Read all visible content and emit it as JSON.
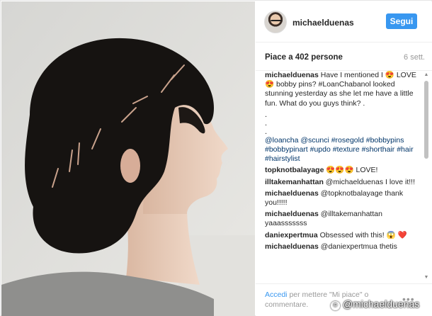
{
  "post": {
    "username": "michaelduenas",
    "follow_label": "Segui",
    "likes": "Piace a 402 persone",
    "date": "6 sett."
  },
  "comments": [
    {
      "user": "michaelduenas",
      "text": "Have I mentioned I 😍 LOVE 😍 bobby pins? #LoanChabanol looked stunning yesterday as she let me have a little fun. What do you guys think? ."
    },
    {
      "user": "",
      "text": "."
    },
    {
      "user": "",
      "text": "."
    },
    {
      "user": "",
      "text": "."
    },
    {
      "user": "",
      "text": "@loancha @scunci #rosegold #bobbypins #bobbypinart #updo #texture #shorthair #hair #hairstylist"
    },
    {
      "user": "topknotbalayage",
      "text": "😍😍😍 LOVE!"
    },
    {
      "user": "illtakemanhattan",
      "text": "@michaelduenas I love it!!!"
    },
    {
      "user": "michaelduenas",
      "text": "@topknotbalayage thank you!!!!!"
    },
    {
      "user": "michaelduenas",
      "text": "@illtakemanhattan yaaasssssss"
    },
    {
      "user": "daniexpertmua",
      "text": "Obsessed with this! 😱 ❤️"
    },
    {
      "user": "michaelduenas",
      "text": "@daniexpertmua thetis"
    }
  ],
  "footer": {
    "login": "Accedi",
    "rest": "per mettere \"Mi piace\" o commentare.",
    "more": "•••"
  },
  "watermark": "@michaelduenas",
  "icons": {
    "avatar": "profile-avatar",
    "more": "more-options-icon",
    "scroll_up": "scroll-up-arrow-icon",
    "scroll_down": "scroll-down-arrow-icon"
  },
  "colors": {
    "follow_button": "#3897f0",
    "link": "#003569",
    "muted": "#999999"
  }
}
